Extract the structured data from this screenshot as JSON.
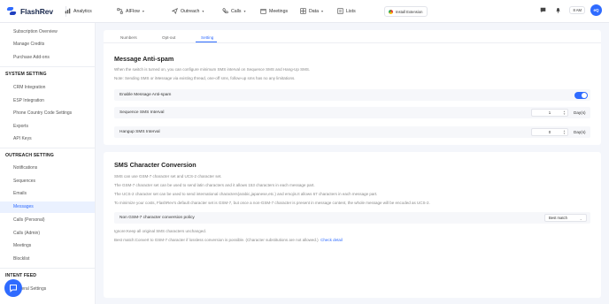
{
  "brand": {
    "name": "FlashRev"
  },
  "topnav": {
    "items": [
      {
        "label": "Analytics"
      },
      {
        "label": "AIFlow"
      },
      {
        "label": "Outreach"
      },
      {
        "label": "Calls"
      },
      {
        "label": "Meetings"
      },
      {
        "label": "Data"
      },
      {
        "label": "Lists"
      }
    ],
    "extension_label": "Install Extension",
    "time": "8 AM",
    "avatar_initials": "eQ"
  },
  "sidebar": {
    "top_items": [
      "Subscription Overview",
      "Manage Credits",
      "Purchase Add-ons"
    ],
    "system_heading": "SYSTEM SETTING",
    "system_items": [
      "CRM Integration",
      "ESP Integration",
      "Phone Country Code Settings",
      "Exports",
      "API Keys"
    ],
    "outreach_heading": "OUTREACH SETTING",
    "outreach_items": [
      "Notifications",
      "Sequences",
      "Emails",
      "Messages",
      "Calls (Personal)",
      "Calls (Admin)",
      "Meetings",
      "Blocklist"
    ],
    "intent_heading": "INTENT FEED",
    "intent_items": [
      "General Settings"
    ]
  },
  "tabs": [
    "Numbers",
    "Opt-out",
    "Setting"
  ],
  "antispam": {
    "title": "Message Anti-spam",
    "desc1": "When the switch is turned on, you can configure minimum SMS interval on Sequence SMS and Hang-Up SMS.",
    "desc2": "Note: Sending SMS or iMessage via existing thread, one-off sms, follow-up sms has no any limitations.",
    "enable_label": "Enable Message Anti-spam",
    "enabled": true,
    "seq_label": "Sequence SMS Interval",
    "seq_value": "1",
    "hangup_label": "Hangup SMS Interval",
    "hangup_value": "0",
    "unit": "Day(s)"
  },
  "conversion": {
    "title": "SMS Character Conversion",
    "lines": [
      "SMS can use GSM-7 character set and UCS-2 character set.",
      "The GSM-7 character set can be used to send latin characters and it allows 153 characters in each message part.",
      "The UCS-2 character set can be used to send international characters(arabic,japanese,etc.) and emojis.It allows 67 characters in each message part.",
      "To minimize your costs, FlashRev's default character set is GSM-7, but once a non-GSM-7 character is present in message content, the whole message will be encoded as UCS-2."
    ],
    "policy_label": "Non GSM-7 character conversion policy",
    "policy_value": "Best match",
    "opt1": "Ignore:Keep all original SMS characters unchanged.",
    "opt2": "Best match:Convert to GSM-7 character if lossless conversion is possible. (Character substitutions are not allowed.)",
    "check_detail": "Check detail"
  },
  "colors": {
    "accent": "#2f6bff",
    "background": "#f4f6fb",
    "card": "#ffffff"
  }
}
